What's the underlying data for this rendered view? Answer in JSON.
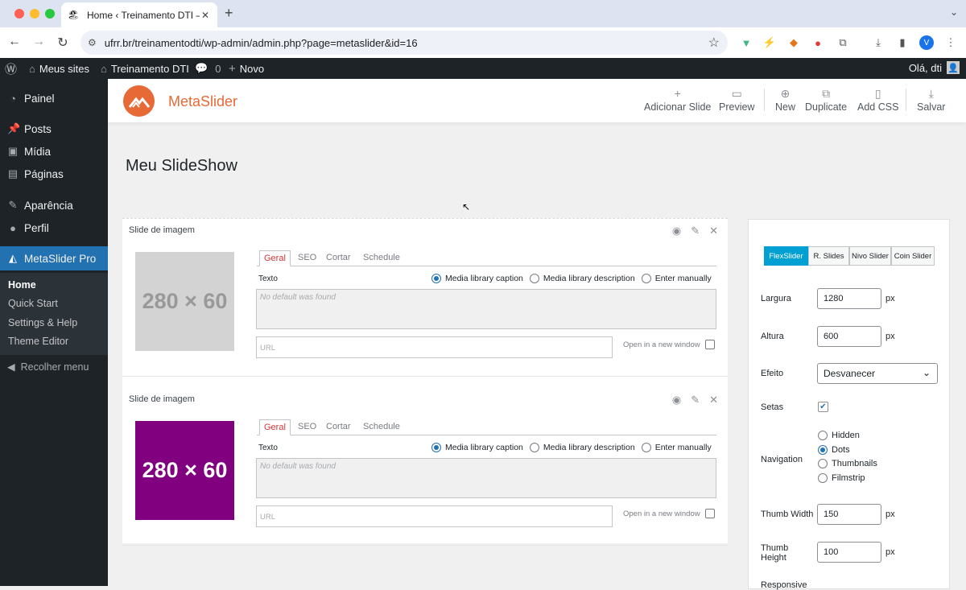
{
  "browser": {
    "tab_title": "Home ‹ Treinamento DTI — W",
    "url": "ufrr.br/treinamentodti/wp-admin/admin.php?page=metaslider&id=16",
    "profile_initial": "V"
  },
  "adminbar": {
    "my_sites": "Meus sites",
    "site_name": "Treinamento DTI",
    "comments": "0",
    "new": "Novo",
    "greeting": "Olá, dti"
  },
  "sidebar": {
    "items": [
      {
        "label": "Painel",
        "icon": "dashboard-icon"
      },
      {
        "label": "Posts",
        "icon": "pin-icon"
      },
      {
        "label": "Mídia",
        "icon": "media-icon"
      },
      {
        "label": "Páginas",
        "icon": "pages-icon"
      },
      {
        "label": "Aparência",
        "icon": "brush-icon"
      },
      {
        "label": "Perfil",
        "icon": "user-icon"
      },
      {
        "label": "MetaSlider Pro",
        "icon": "metaslider-icon"
      }
    ],
    "submenu": [
      "Home",
      "Quick Start",
      "Settings & Help",
      "Theme Editor"
    ],
    "collapse": "Recolher menu"
  },
  "toolbar": {
    "brand": "MetaSlider",
    "add_slide": "Adicionar Slide",
    "preview": "Preview",
    "new": "New",
    "duplicate": "Duplicate",
    "add_css": "Add CSS",
    "save": "Salvar"
  },
  "page_title": "Meu SlideShow",
  "slides": [
    {
      "title": "Slide de imagem",
      "thumb_text": "280 × 60",
      "thumb_bg": "#d3d3d3",
      "thumb_color": "#999999",
      "tabs": [
        "Geral",
        "SEO",
        "Cortar",
        "Schedule"
      ],
      "text_label": "Texto",
      "radio_caption": "Media library caption",
      "radio_description": "Media library description",
      "radio_manual": "Enter manually",
      "textarea_placeholder": "No default was found",
      "url_placeholder": "URL",
      "new_window": "Open in a new window"
    },
    {
      "title": "Slide de imagem",
      "thumb_text": "280 × 60",
      "thumb_bg": "#800080",
      "thumb_color": "#ffffff",
      "tabs": [
        "Geral",
        "SEO",
        "Cortar",
        "Schedule"
      ],
      "text_label": "Texto",
      "radio_caption": "Media library caption",
      "radio_description": "Media library description",
      "radio_manual": "Enter manually",
      "textarea_placeholder": "No default was found",
      "url_placeholder": "URL",
      "new_window": "Open in a new window"
    }
  ],
  "settings": {
    "libraries": [
      "FlexSlider",
      "R. Slides",
      "Nivo Slider",
      "Coin Slider"
    ],
    "width_label": "Largura",
    "width_value": "1280",
    "height_label": "Altura",
    "height_value": "600",
    "px": "px",
    "effect_label": "Efeito",
    "effect_value": "Desvanecer",
    "arrows_label": "Setas",
    "navigation_label": "Navigation",
    "navigation_options": [
      "Hidden",
      "Dots",
      "Thumbnails",
      "Filmstrip"
    ],
    "navigation_selected": "Dots",
    "thumb_width_label": "Thumb Width",
    "thumb_width_value": "150",
    "thumb_height_label": "Thumb Height",
    "thumb_height_value": "100",
    "responsive_label": "Responsive"
  }
}
